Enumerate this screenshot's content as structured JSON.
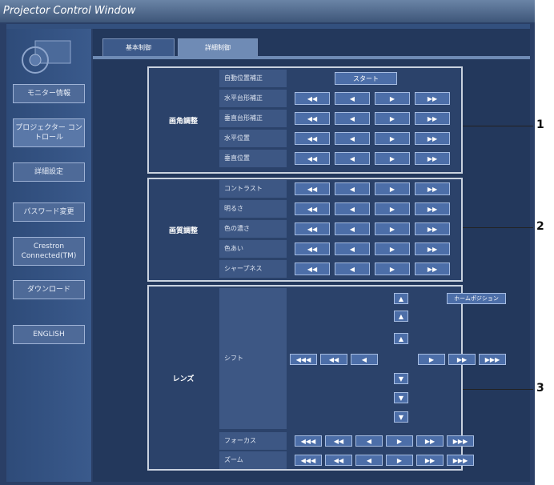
{
  "window": {
    "title": "Projector Control Window"
  },
  "sidebar": {
    "items": [
      {
        "label": "モニター情報"
      },
      {
        "label": "プロジェクター コントロール"
      },
      {
        "label": "詳細設定"
      },
      {
        "label": "パスワード変更"
      },
      {
        "label": "Crestron Connected(TM)"
      },
      {
        "label": "ダウンロード"
      },
      {
        "label": "ENGLISH"
      }
    ]
  },
  "tabs": [
    {
      "label": "基本制御"
    },
    {
      "label": "詳細制御"
    }
  ],
  "arrows": {
    "fast_left": "◀◀",
    "left": "◀",
    "right": "▶",
    "fast_right": "▶▶",
    "left3": "◀◀◀",
    "right3": "▶▶▶"
  },
  "sections": {
    "angle": {
      "title": "画角調整",
      "auto_label": "自動位置補正",
      "start": "スタート",
      "rows": [
        "水平台形補正",
        "垂直台形補正",
        "水平位置",
        "垂直位置"
      ]
    },
    "picture": {
      "title": "画質調整",
      "rows": [
        "コントラスト",
        "明るさ",
        "色の濃さ",
        "色あい",
        "シャープネス"
      ]
    },
    "lens": {
      "title": "レンズ",
      "shift_label": "シフト",
      "home_position": "ホームポジション",
      "focus_label": "フォーカス",
      "zoom_label": "ズーム"
    }
  },
  "callouts": [
    "1",
    "2",
    "3"
  ]
}
